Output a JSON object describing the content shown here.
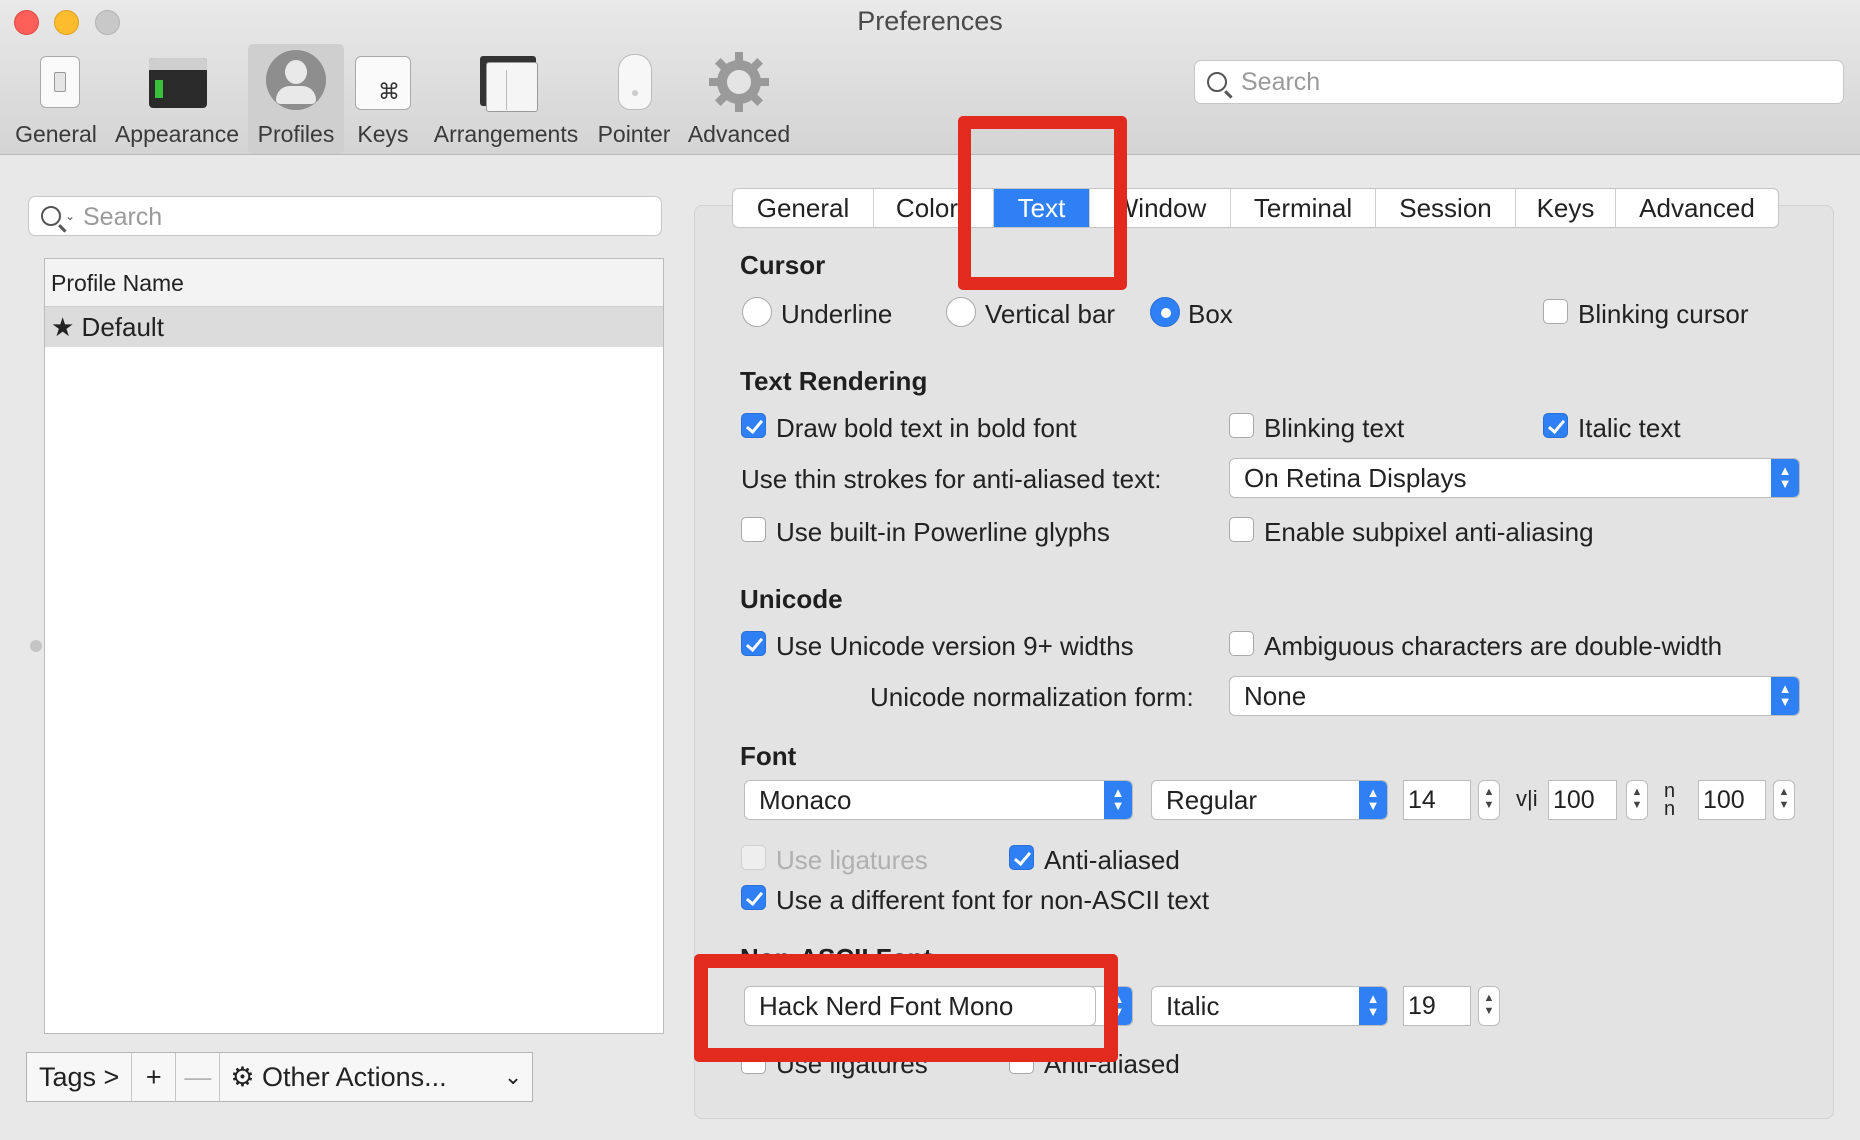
{
  "window": {
    "title": "Preferences"
  },
  "toolbar": {
    "items": [
      {
        "label": "General"
      },
      {
        "label": "Appearance"
      },
      {
        "label": "Profiles"
      },
      {
        "label": "Keys"
      },
      {
        "label": "Arrangements"
      },
      {
        "label": "Pointer"
      },
      {
        "label": "Advanced"
      }
    ],
    "selected": "Profiles",
    "search_placeholder": "Search"
  },
  "sidebar": {
    "search_placeholder": "Search",
    "column_header": "Profile Name",
    "profiles": [
      {
        "name": "Default",
        "default": true
      }
    ],
    "bottom": {
      "tags": "Tags >",
      "add": "+",
      "remove": "—",
      "other_actions": "Other Actions..."
    }
  },
  "tabs": {
    "items": [
      "General",
      "Colors",
      "Text",
      "Window",
      "Terminal",
      "Session",
      "Keys",
      "Advanced"
    ],
    "selected": "Text"
  },
  "cursor": {
    "heading": "Cursor",
    "options": [
      "Underline",
      "Vertical bar",
      "Box"
    ],
    "selected": "Box",
    "blinking_label": "Blinking cursor",
    "blinking": false
  },
  "rendering": {
    "heading": "Text Rendering",
    "bold_label": "Draw bold text in bold font",
    "bold": true,
    "blinking_text_label": "Blinking text",
    "blinking_text": false,
    "italic_label": "Italic text",
    "italic": true,
    "thin_strokes_label": "Use thin strokes for anti-aliased text:",
    "thin_strokes_value": "On Retina Displays",
    "powerline_label": "Use built-in Powerline glyphs",
    "powerline": false,
    "subpixel_label": "Enable subpixel anti-aliasing",
    "subpixel": false
  },
  "unicode": {
    "heading": "Unicode",
    "widths_label": "Use Unicode version 9+ widths",
    "widths": true,
    "ambiguous_label": "Ambiguous characters are double-width",
    "ambiguous": false,
    "normalization_label": "Unicode normalization form:",
    "normalization_value": "None"
  },
  "font": {
    "heading": "Font",
    "family": "Monaco",
    "style": "Regular",
    "size": "14",
    "vertical_spacing": "100",
    "horizontal_spacing": "100",
    "ligatures_label": "Use ligatures",
    "ligatures": false,
    "antialiased_label": "Anti-aliased",
    "antialiased": true,
    "non_ascii_label": "Use a different font for non-ASCII text",
    "non_ascii": true
  },
  "non_ascii_font": {
    "heading": "Non-ASCII Font",
    "family": "Hack Nerd Font Mono",
    "style": "Italic",
    "size": "19",
    "ligatures_label": "Use ligatures",
    "ligatures": false,
    "antialiased_label": "Anti-aliased",
    "antialiased": false
  },
  "colors": {
    "accent": "#2f7ff5",
    "highlight": "#e22a1e",
    "close": "#fc5f57",
    "minimize": "#fdbc2e",
    "zoom": "#c8c8c8"
  }
}
